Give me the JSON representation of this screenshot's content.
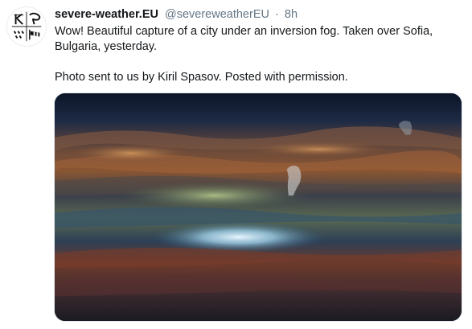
{
  "tweet": {
    "display_name": "severe-weather.EU",
    "handle": "@severeweatherEU",
    "separator": "·",
    "time": "8h",
    "text_line1": "Wow! Beautiful capture of a city under an inversion fog. Taken over Sofia, Bulgaria, yesterday.",
    "text_line2": "Photo sent to us by Kiril Spasov. Posted with permission."
  },
  "avatar": {
    "icon": "severe-weather-logo-icon"
  },
  "media": {
    "icon": "inversion-fog-photo"
  },
  "colors": {
    "text": "#14171a",
    "secondary_text": "#657786",
    "border": "#e1e8ed"
  }
}
